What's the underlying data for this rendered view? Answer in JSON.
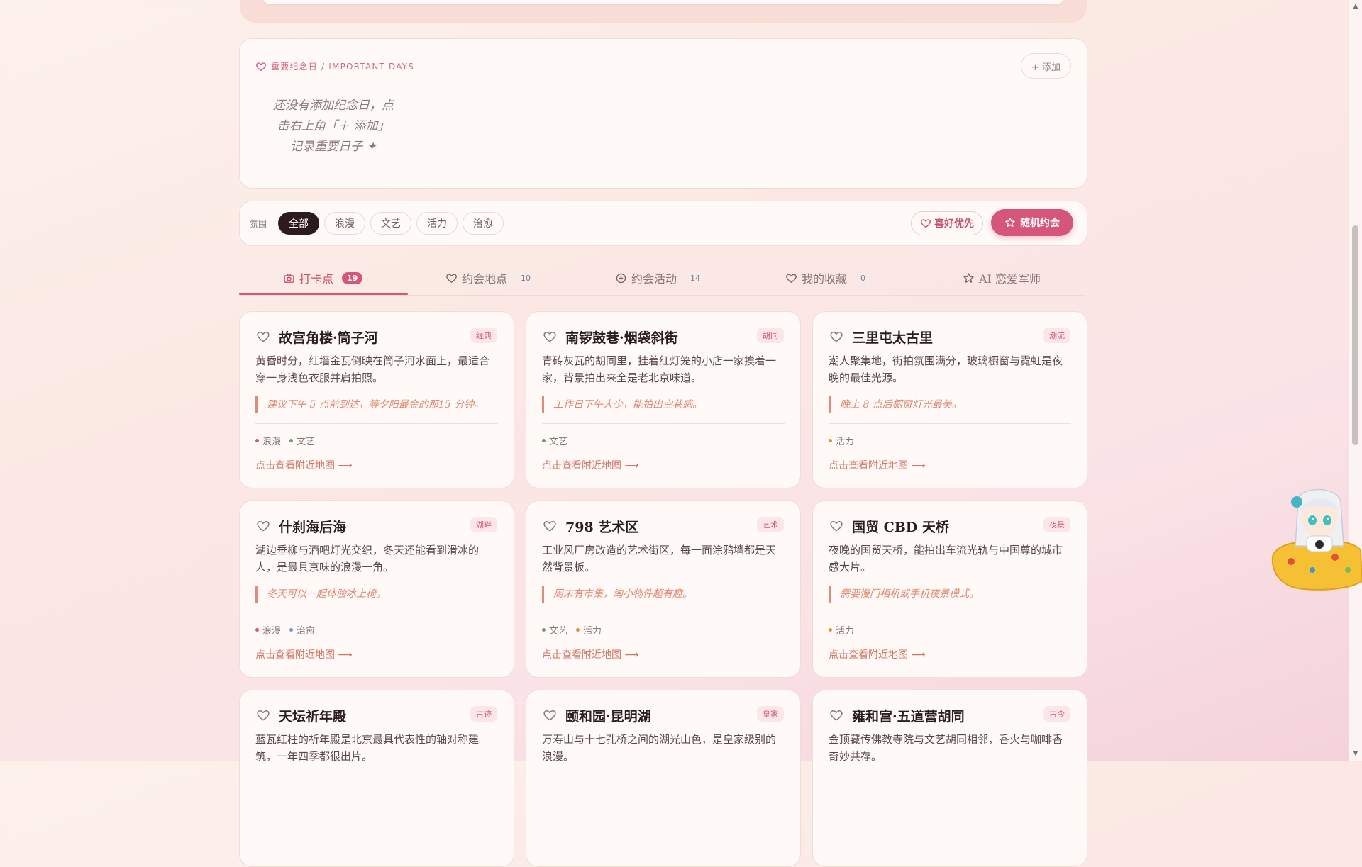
{
  "important_days": {
    "title": "重要纪念日 / IMPORTANT DAYS",
    "add_button": "+ 添加",
    "empty_lines": [
      "还没有添加纪念日，点",
      "击右上角「＋ 添加」",
      "记录重要日子 ✦"
    ]
  },
  "filter": {
    "label": "氛围",
    "chips": [
      "全部",
      "浪漫",
      "文艺",
      "活力",
      "治愈"
    ],
    "active_chip": "全部",
    "fav_first": "喜好优先",
    "random_date": "随机约会"
  },
  "tabs": [
    {
      "label": "打卡点",
      "count": "19",
      "icon": "camera-icon",
      "active": true
    },
    {
      "label": "约会地点",
      "count": "10",
      "icon": "heart-icon",
      "active": false
    },
    {
      "label": "约会活动",
      "count": "14",
      "icon": "plus-circle-icon",
      "active": false
    },
    {
      "label": "我的收藏",
      "count": "0",
      "icon": "heart-icon",
      "active": false
    },
    {
      "label": "AI 恋爱军师",
      "count": "",
      "icon": "star-icon",
      "active": false
    }
  ],
  "map_link_label": "点击查看附近地图 ⟶",
  "tag_colors": {
    "浪漫": "#d6567a",
    "文艺": "#6f9a6a",
    "活力": "#e0922a",
    "治愈": "#6a9ad0"
  },
  "cards": [
    {
      "title": "故宫角楼·筒子河",
      "badge": "经典",
      "desc": "黄昏时分，红墙金瓦倒映在筒子河水面上，最适合穿一身浅色衣服并肩拍照。",
      "tip": "建议下午 5 点前到达，等夕阳最金的那15 分钟。",
      "tags": [
        "浪漫",
        "文艺"
      ]
    },
    {
      "title": "南锣鼓巷·烟袋斜街",
      "badge": "胡同",
      "desc": "青砖灰瓦的胡同里，挂着红灯笼的小店一家挨着一家，背景拍出来全是老北京味道。",
      "tip": "工作日下午人少，能拍出空巷感。",
      "tags": [
        "文艺"
      ]
    },
    {
      "title": "三里屯太古里",
      "badge": "潮流",
      "desc": "潮人聚集地，街拍氛围满分，玻璃橱窗与霓虹是夜晚的最佳光源。",
      "tip": "晚上 8 点后橱窗灯光最美。",
      "tags": [
        "活力"
      ]
    },
    {
      "title": "什刹海后海",
      "badge": "湖畔",
      "desc": "湖边垂柳与酒吧灯光交织，冬天还能看到滑冰的人，是最具京味的浪漫一角。",
      "tip": "冬天可以一起体验冰上椅。",
      "tags": [
        "浪漫",
        "治愈"
      ]
    },
    {
      "title": "798 艺术区",
      "badge": "艺术",
      "desc": "工业风厂房改造的艺术街区，每一面涂鸦墙都是天然背景板。",
      "tip": "周末有市集，淘小物件超有趣。",
      "tags": [
        "文艺",
        "活力"
      ]
    },
    {
      "title": "国贸 CBD 天桥",
      "badge": "夜景",
      "desc": "夜晚的国贸天桥，能拍出车流光轨与中国尊的城市感大片。",
      "tip": "需要慢门相机或手机夜景模式。",
      "tags": [
        "活力"
      ]
    },
    {
      "title": "天坛祈年殿",
      "badge": "古迹",
      "desc": "蓝瓦红柱的祈年殿是北京最具代表性的轴对称建筑，一年四季都很出片。",
      "tip": "",
      "tags": []
    },
    {
      "title": "颐和园·昆明湖",
      "badge": "皇家",
      "desc": "万寿山与十七孔桥之间的湖光山色，是皇家级别的浪漫。",
      "tip": "",
      "tags": []
    },
    {
      "title": "雍和宫·五道营胡同",
      "badge": "古今",
      "desc": "金顶藏传佛教寺院与文艺胡同相邻，香火与咖啡香奇妙共存。",
      "tip": "",
      "tags": []
    }
  ]
}
